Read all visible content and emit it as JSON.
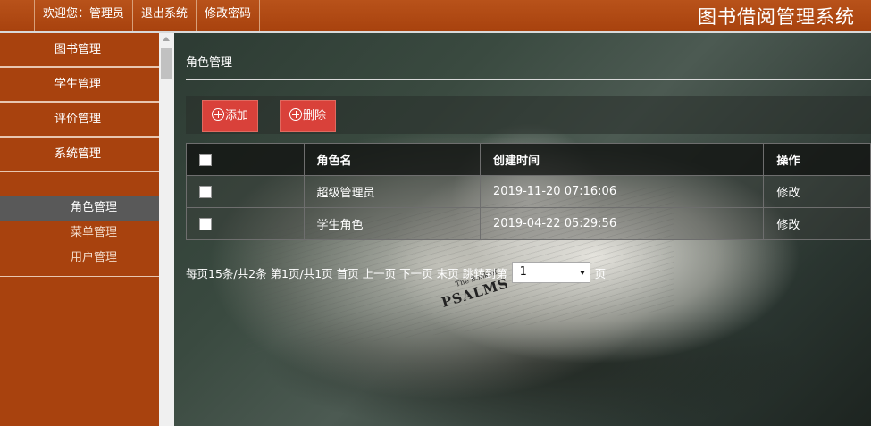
{
  "header": {
    "welcome": "欢迎您：管理员",
    "logout": "退出系统",
    "change_password": "修改密码",
    "app_title": "图书借阅管理系统"
  },
  "sidebar": {
    "items": [
      {
        "label": "图书管理"
      },
      {
        "label": "学生管理"
      },
      {
        "label": "评价管理"
      },
      {
        "label": "系统管理"
      }
    ],
    "subitems": [
      {
        "label": "角色管理",
        "active": true
      },
      {
        "label": "菜单管理"
      },
      {
        "label": "用户管理"
      }
    ]
  },
  "main": {
    "page_title": "角色管理",
    "toolbar": {
      "add_label": "添加",
      "delete_label": "删除"
    },
    "table": {
      "columns": [
        "角色名",
        "创建时间",
        "操作"
      ],
      "rows": [
        {
          "name": "超级管理员",
          "created": "2019-11-20 07:16:06",
          "action": "修改"
        },
        {
          "name": "学生角色",
          "created": "2019-04-22 05:29:56",
          "action": "修改"
        }
      ]
    },
    "pager": {
      "summary": "每页15条/共2条 第1页/共1页",
      "first": "首页",
      "prev": "上一页",
      "next": "下一页",
      "last": "末页",
      "jump_label": "跳转到第",
      "current_page": "1",
      "page_suffix": "页"
    },
    "background": {
      "book_heading": "The Book of",
      "book_title": "PSALMS"
    }
  },
  "colors": {
    "brand": "#a8420e",
    "button": "#d9413a",
    "active_subitem": "#595959"
  }
}
